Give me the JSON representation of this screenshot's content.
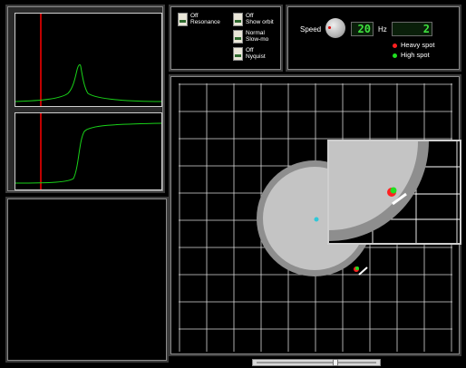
{
  "controls": {
    "resonance_state": "Off",
    "resonance_label": "Resonance",
    "orbit_state": "Off",
    "orbit_label": "Show orbit",
    "motion_state": "Normal",
    "motion_label": "Slow-mo",
    "nyquist_state": "Off",
    "nyquist_label": "Nyquist"
  },
  "speed": {
    "label": "Speed",
    "value": "20",
    "hz_label": "Hz",
    "hz_value": "2",
    "knob_icon": "rotary-knob-icon"
  },
  "legend": {
    "heavy_label": "Heavy spot",
    "heavy_color": "#ff2020",
    "high_label": "High spot",
    "high_color": "#20e020"
  },
  "colors": {
    "curve": "#19d219",
    "marker": "#c00000",
    "grid": "#ffffff",
    "disc": "#c4c4c4",
    "disc_rim": "#8e8e8e"
  }
}
